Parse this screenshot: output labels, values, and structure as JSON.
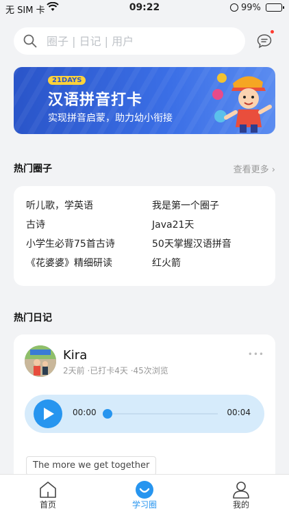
{
  "status_bar": {
    "carrier": "无 SIM 卡",
    "time": "09:22",
    "battery": "99%"
  },
  "search": {
    "placeholder": "圈子 | 日记 | 用户"
  },
  "banner": {
    "tag": "21DAYS",
    "title": "汉语拼音打卡",
    "subtitle": "实现拼音启蒙，助力幼小衔接"
  },
  "hot_circles": {
    "title": "热门圈子",
    "more": "查看更多 ›",
    "items": [
      "听儿歌，学英语",
      "我是第一个圈子",
      "古诗",
      "Java21天",
      "小学生必背75首古诗",
      "50天掌握汉语拼音",
      "《花婆婆》精细研读",
      "红火箭"
    ]
  },
  "hot_diary": {
    "title": "热门日记",
    "post": {
      "username": "Kira",
      "meta": "2天前 ·已打卡4天 ·45次浏览",
      "more": "•••",
      "audio": {
        "current": "00:00",
        "duration": "00:04",
        "progress": 0
      },
      "text": "The more we get together"
    }
  },
  "tabbar": {
    "items": [
      {
        "label": "首页",
        "icon": "home-icon",
        "active": false
      },
      {
        "label": "学习圈",
        "icon": "smile-icon",
        "active": true
      },
      {
        "label": "我的",
        "icon": "user-icon",
        "active": false
      }
    ]
  },
  "colors": {
    "accent": "#2795ef",
    "background": "#f2f3f5",
    "banner": "#3b6fe6",
    "badge": "#ff3b30"
  }
}
